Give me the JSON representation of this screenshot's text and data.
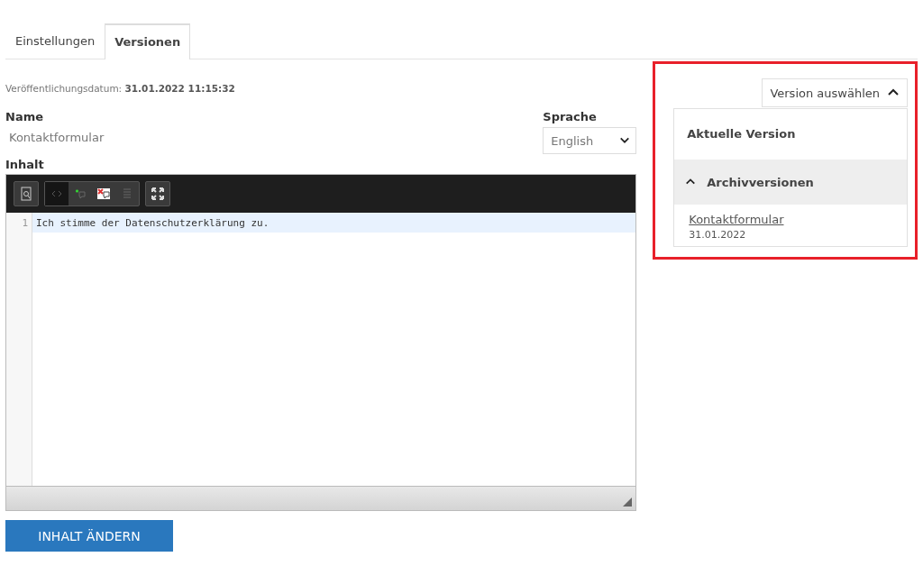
{
  "tabs": [
    {
      "label": "Einstellungen",
      "selected": false
    },
    {
      "label": "Versionen",
      "selected": true
    }
  ],
  "publish_date": {
    "label": "Veröffentlichungsdatum:",
    "value": "31.01.2022 11:15:32"
  },
  "name": {
    "label": "Name",
    "value": "Kontaktformular"
  },
  "language": {
    "label": "Sprache",
    "value": "English"
  },
  "content": {
    "label": "Inhalt",
    "lines": [
      {
        "number": "1",
        "text": "Ich stimme der Datenschutzerklärung zu.",
        "active": true
      }
    ]
  },
  "submit_button": "INHALT ÄNDERN",
  "version_picker": {
    "label": "Version auswählen",
    "expanded": true,
    "current": "Aktuelle Version",
    "archive": {
      "label": "Archivversionen",
      "expanded": true,
      "items": [
        {
          "title": "Kontaktformular",
          "date": "31.01.2022"
        }
      ]
    }
  }
}
